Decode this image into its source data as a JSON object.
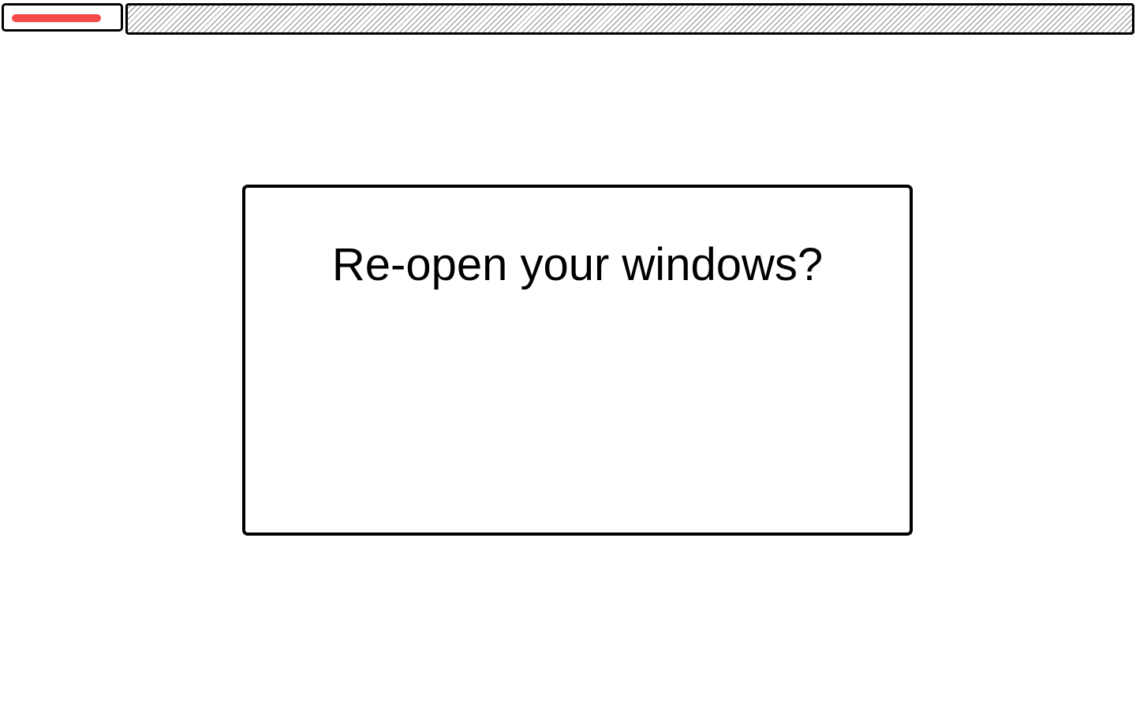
{
  "top_bar": {
    "progress": {
      "value_fraction": 0.88,
      "color": "#f44a4a"
    }
  },
  "dialog": {
    "title": "Re-open your windows?"
  }
}
